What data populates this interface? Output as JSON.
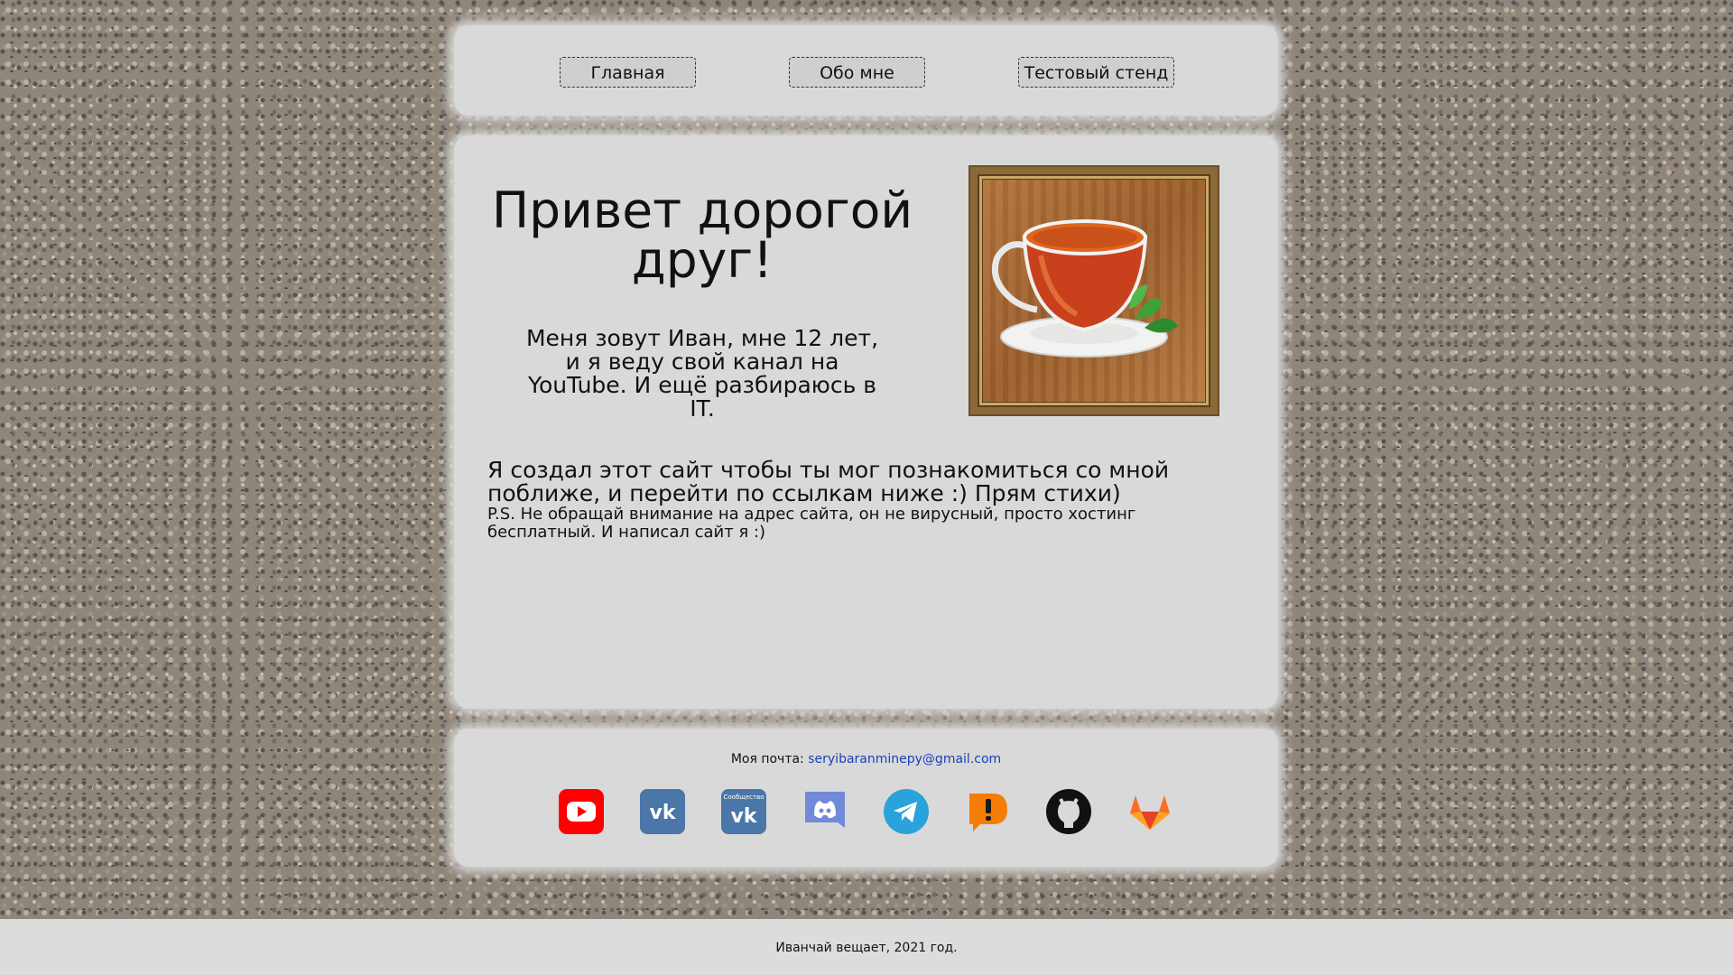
{
  "nav": {
    "home_label": "Главная",
    "about_label": "Обо мне",
    "test_label": "Тестовый стенд"
  },
  "hero": {
    "title": "Привет дорогой друг!",
    "intro": "Меня зовут Иван, мне 12 лет, и я веду свой канал на YouTube. И ещё разбираюсь в IT.",
    "image_icon": "tea-cup-icon"
  },
  "about": {
    "site_text": "Я создал этот сайт чтобы ты мог познакомиться со мной поближе, и перейти по ссылкам ниже :) Прям стихи)",
    "ps_text": "P.S. Не обращай внимание на адрес сайта, он не вирусный, просто хостинг бесплатный. И написал сайт я :)"
  },
  "contacts": {
    "email_label": "Моя почта:",
    "email": "seryibaranminepy@gmail.com",
    "vk_group_caption": "Сообщество",
    "social_icons": [
      "youtube-icon",
      "vk-icon",
      "vk-community-icon",
      "discord-icon",
      "telegram-icon",
      "donationalerts-icon",
      "github-icon",
      "gitlab-icon"
    ]
  },
  "colors": {
    "panel": "#d9d9d9",
    "link": "#1a3fb5",
    "youtube": "#ff0000",
    "vk": "#4a76a8",
    "discord": "#7289da",
    "telegram": "#2aa3dc",
    "donationalerts": "#f57d07",
    "gitlab": "#fc6d26"
  },
  "footer": {
    "text": "Иванчай вещает, 2021 год."
  }
}
